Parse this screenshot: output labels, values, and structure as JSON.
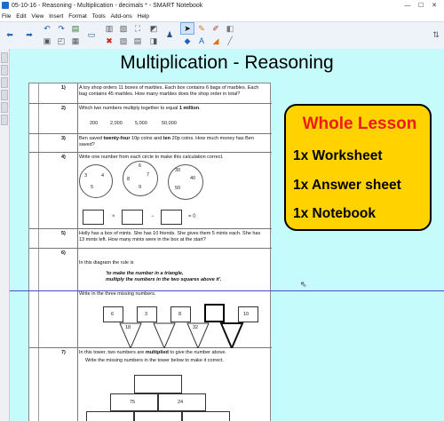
{
  "window": {
    "title": "05-10-16 - Reasoning - Multiplication - decimals * - SMART Notebook",
    "minimize": "—",
    "maximize": "☐",
    "close": "✕"
  },
  "menu": [
    "File",
    "Edit",
    "View",
    "Insert",
    "Format",
    "Tools",
    "Add-ons",
    "Help"
  ],
  "page_title": "Multiplication - Reasoning",
  "worksheet": {
    "q1": {
      "num": "1)",
      "text": "A toy shop orders 11 boxes of marbles. Each box contains 6 bags of marbles. Each bag contains 45 marbles. How many marbles does the shop order in total?"
    },
    "q2": {
      "num": "2)",
      "text_a": "Which two numbers multiply together to equal ",
      "text_b": "1 million",
      "text_c": ".",
      "options": [
        "200",
        "2,000",
        "5,000",
        "50,000"
      ]
    },
    "q3": {
      "num": "3)",
      "text_a": "Ben saved ",
      "text_b": "twenty-four",
      "text_c": " 10p coins and ",
      "text_d": "ten",
      "text_e": " 20p coins. How much money has Ben saved?"
    },
    "q4": {
      "num": "4)",
      "text": "Write one number from each circle to make this calculation correct.",
      "circle1": [
        "3",
        "4",
        "5"
      ],
      "circle2": [
        "6",
        "7",
        "8",
        "9"
      ],
      "circle3": [
        "30",
        "40",
        "50"
      ],
      "times": "×",
      "minus": "−",
      "equals": "= 0"
    },
    "q5": {
      "num": "5)",
      "text": "Holly has a box of mints. She has 10 friends. She gives them 5 mints each. She has 13 mints left. How many mints were in the box at the start?"
    },
    "q6": {
      "num": "6)",
      "intro": "In this diagram the rule is",
      "rule_a": "'to make the number in a triangle,",
      "rule_b": "multiply the numbers in the two squares above it'.",
      "instruction": "Write in the three missing numbers.",
      "squares": [
        "6",
        "3",
        "8",
        "",
        "10"
      ],
      "triangles": [
        "18",
        "32",
        ""
      ]
    },
    "q7": {
      "num": "7)",
      "text_a": "In this tower, two numbers are ",
      "text_b": "multiplied",
      "text_c": " to give the number above.",
      "instruction": "Write the missing numbers in the tower below to make it correct.",
      "tower_row2": [
        "75",
        "24"
      ]
    }
  },
  "lesson_box": {
    "title": "Whole Lesson",
    "items": [
      "1x Worksheet",
      "1x Answer sheet",
      "1x Notebook"
    ]
  }
}
